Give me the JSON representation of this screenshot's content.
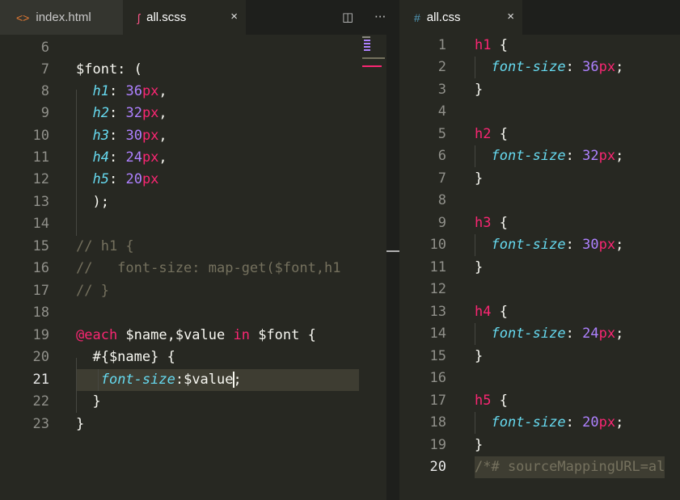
{
  "tabs_left": [
    {
      "label": "index.html",
      "icon": "code-icon",
      "active": false
    },
    {
      "label": "all.scss",
      "icon": "sass-icon",
      "active": true,
      "close": "×"
    }
  ],
  "tabs_right": [
    {
      "label": "all.css",
      "icon": "hash-icon",
      "active": true,
      "close": "×"
    }
  ],
  "toolbar": {
    "split_icon": "split-editor-icon",
    "more_icon": "more-icon"
  },
  "editor_left": {
    "current_line": "21",
    "lines": [
      {
        "n": "6",
        "t": ""
      },
      {
        "n": "7",
        "t": "$font: ("
      },
      {
        "n": "8",
        "t": "  h1: 36px,"
      },
      {
        "n": "9",
        "t": "  h2: 32px,"
      },
      {
        "n": "10",
        "t": "  h3: 30px,"
      },
      {
        "n": "11",
        "t": "  h4: 24px,"
      },
      {
        "n": "12",
        "t": "  h5: 20px"
      },
      {
        "n": "13",
        "t": "  );"
      },
      {
        "n": "14",
        "t": ""
      },
      {
        "n": "15",
        "t": "// h1 {"
      },
      {
        "n": "16",
        "t": "//   font-size: map-get($font,h1"
      },
      {
        "n": "17",
        "t": "// }"
      },
      {
        "n": "18",
        "t": ""
      },
      {
        "n": "19",
        "t": "@each $name,$value in $font {"
      },
      {
        "n": "20",
        "t": "  #{$name} {"
      },
      {
        "n": "21",
        "t": "   font-size:$value;"
      },
      {
        "n": "22",
        "t": "  }"
      },
      {
        "n": "23",
        "t": "}"
      }
    ]
  },
  "editor_right": {
    "current_line": "20",
    "lines": [
      {
        "n": "1",
        "t": "h1 {"
      },
      {
        "n": "2",
        "t": "  font-size: 36px;"
      },
      {
        "n": "3",
        "t": "}"
      },
      {
        "n": "4",
        "t": ""
      },
      {
        "n": "5",
        "t": "h2 {"
      },
      {
        "n": "6",
        "t": "  font-size: 32px;"
      },
      {
        "n": "7",
        "t": "}"
      },
      {
        "n": "8",
        "t": ""
      },
      {
        "n": "9",
        "t": "h3 {"
      },
      {
        "n": "10",
        "t": "  font-size: 30px;"
      },
      {
        "n": "11",
        "t": "}"
      },
      {
        "n": "12",
        "t": ""
      },
      {
        "n": "13",
        "t": "h4 {"
      },
      {
        "n": "14",
        "t": "  font-size: 24px;"
      },
      {
        "n": "15",
        "t": "}"
      },
      {
        "n": "16",
        "t": ""
      },
      {
        "n": "17",
        "t": "h5 {"
      },
      {
        "n": "18",
        "t": "  font-size: 20px;"
      },
      {
        "n": "19",
        "t": "}"
      },
      {
        "n": "20",
        "t": "/*# sourceMappingURL=al"
      }
    ]
  },
  "colors": {
    "background": "#272822",
    "keyword": "#f92672",
    "number": "#ae81ff",
    "property": "#66d9ef",
    "comment": "#75715e"
  }
}
